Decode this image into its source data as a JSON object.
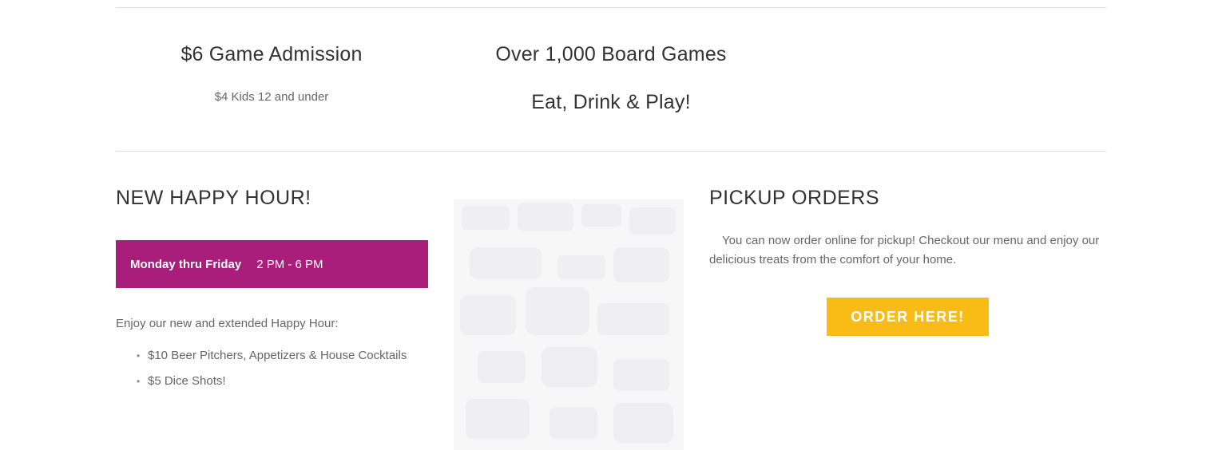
{
  "promo": {
    "admission_title": "$6 Game Admission",
    "admission_sub": "$4 Kids 12 and under",
    "games_title": "Over 1,000 Board Games",
    "games_sub": "Eat, Drink & Play!"
  },
  "happy_hour": {
    "title": "NEW HAPPY HOUR!",
    "days": "Monday thru Friday",
    "time": "2 PM - 6 PM",
    "intro": "Enjoy our new and extended Happy Hour:",
    "items": [
      "$10 Beer Pitchers, Appetizers & House Cocktails",
      "$5 Dice Shots!"
    ],
    "bullet": "•",
    "bar_color": "#a91e7a"
  },
  "pickup": {
    "title": "PICKUP ORDERS",
    "text": "You can now order online for pickup! Checkout our menu and enjoy our delicious treats from the comfort of your home.",
    "button_label": "ORDER HERE!",
    "button_color": "#f9bb16"
  }
}
